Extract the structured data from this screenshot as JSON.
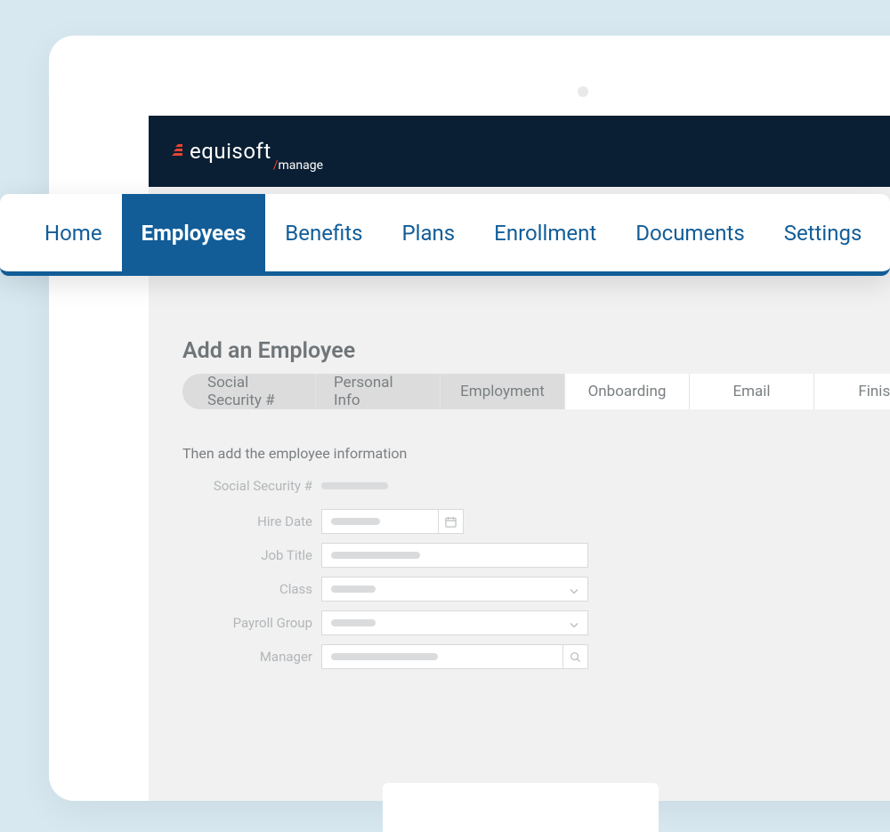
{
  "brand": {
    "name": "equisoft",
    "subproduct": "manage"
  },
  "nav": {
    "items": [
      {
        "label": "Home",
        "active": false
      },
      {
        "label": "Employees",
        "active": true
      },
      {
        "label": "Benefits",
        "active": false
      },
      {
        "label": "Plans",
        "active": false
      },
      {
        "label": "Enrollment",
        "active": false
      },
      {
        "label": "Documents",
        "active": false
      },
      {
        "label": "Settings",
        "active": false
      }
    ]
  },
  "page": {
    "title": "Add an Employee",
    "section_text": "Then add the employee information"
  },
  "wizard": {
    "steps": [
      {
        "label": "Social Security #",
        "state": "shaded"
      },
      {
        "label": "Personal Info",
        "state": "shaded"
      },
      {
        "label": "Employment",
        "state": "shaded"
      },
      {
        "label": "Onboarding",
        "state": "light"
      },
      {
        "label": "Email",
        "state": "light"
      },
      {
        "label": "Finish",
        "state": "light"
      }
    ]
  },
  "form": {
    "fields": {
      "ssn": {
        "label": "Social Security #"
      },
      "hire": {
        "label": "Hire Date"
      },
      "jobtitle": {
        "label": "Job Title"
      },
      "class": {
        "label": "Class"
      },
      "payroll": {
        "label": "Payroll Group"
      },
      "manager": {
        "label": "Manager"
      }
    }
  }
}
